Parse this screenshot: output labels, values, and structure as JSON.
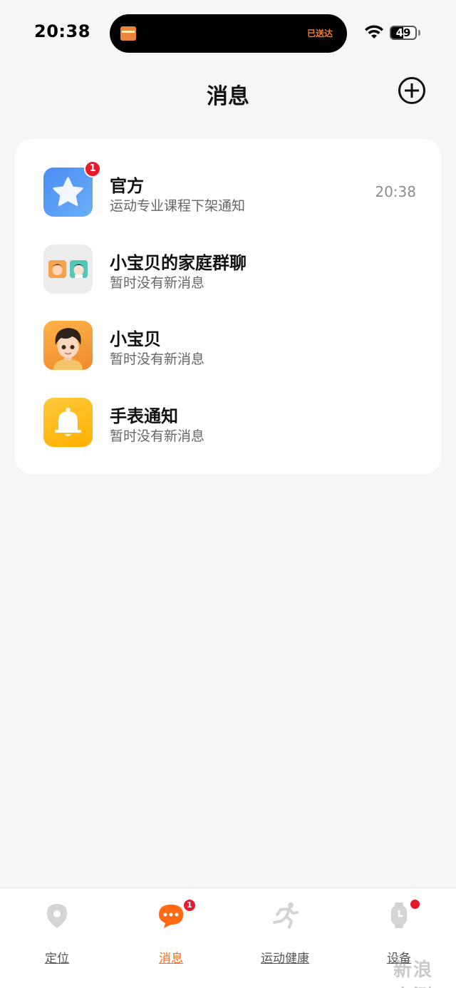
{
  "status_bar": {
    "time": "20:38",
    "island_text": "已送达",
    "battery_level": "49",
    "battery_fraction": 0.49
  },
  "header": {
    "title": "消息",
    "add_icon": "plus-circle-icon"
  },
  "conversations": [
    {
      "name": "官方",
      "preview": "运动专业课程下架通知",
      "time": "20:38",
      "badge": "1",
      "icon": "star-icon",
      "color": "#4a8df6"
    },
    {
      "name": "小宝贝的家庭群聊",
      "preview": "暂时没有新消息",
      "time": "",
      "badge": "",
      "icon": "group-avatar-icon",
      "color": "#ececec"
    },
    {
      "name": "小宝贝",
      "preview": "暂时没有新消息",
      "time": "",
      "badge": "",
      "icon": "kid-avatar-icon",
      "color": "#f5a03a"
    },
    {
      "name": "手表通知",
      "preview": "暂时没有新消息",
      "time": "",
      "badge": "",
      "icon": "bell-icon",
      "color": "#ffbd24"
    }
  ],
  "tabbar": {
    "tabs": [
      {
        "label": "定位",
        "icon": "location-pin-icon",
        "active": false
      },
      {
        "label": "消息",
        "icon": "chat-bubble-icon",
        "active": true,
        "badge": "1"
      },
      {
        "label": "运动健康",
        "icon": "running-icon",
        "active": false
      },
      {
        "label": "设备",
        "icon": "watch-icon",
        "active": false,
        "dot": true
      }
    ]
  },
  "colors": {
    "accent": "#ff6a13",
    "badge": "#e8192c",
    "background": "#f6f6f6"
  },
  "watermark": "新浪 众测"
}
